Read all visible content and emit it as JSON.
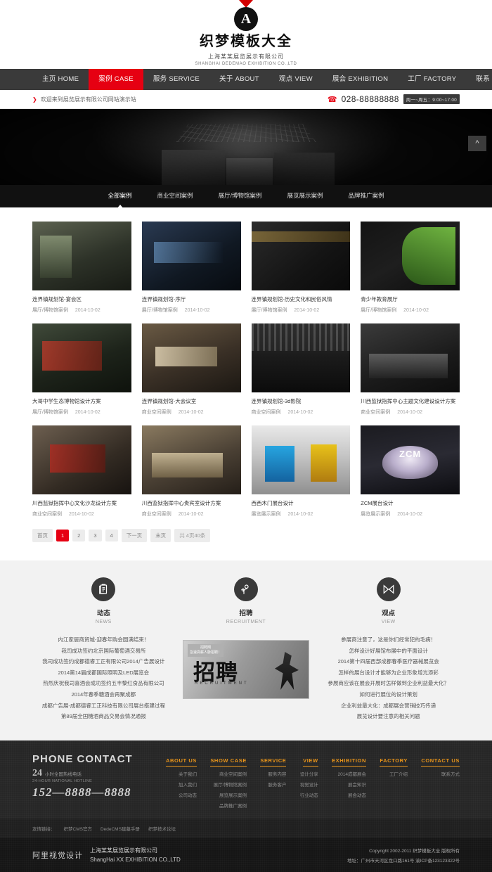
{
  "header": {
    "logo_letter": "A",
    "logo_title": "织梦模板大全",
    "company_cn": "上海某某展览展示有限公司",
    "company_en": "SHANGHAI DEDEMAO EXHIBITION CO.,LTD"
  },
  "nav": {
    "items": [
      {
        "label": "主页 HOME",
        "active": false
      },
      {
        "label": "案例 CASE",
        "active": true
      },
      {
        "label": "服务 SERVICE",
        "active": false
      },
      {
        "label": "关于 ABOUT",
        "active": false
      },
      {
        "label": "观点 VIEW",
        "active": false
      },
      {
        "label": "展会 EXHIBITION",
        "active": false
      },
      {
        "label": "工厂 FACTORY",
        "active": false
      },
      {
        "label": "联系 CONTACT",
        "active": false
      }
    ]
  },
  "welcome": {
    "text": "欢迎来到展览展示有限公司网站演示站",
    "arrow": "❯",
    "phone_icon": "phone-icon",
    "phone": "028-88888888",
    "hours_badge": "周一~周五：9:00~17:00"
  },
  "banner": {
    "backtop_icon": "chevron-up-icon"
  },
  "categories": [
    {
      "label": "全部案例",
      "active": true
    },
    {
      "label": "商业空间案例",
      "active": false
    },
    {
      "label": "展厅/博物馆案例",
      "active": false
    },
    {
      "label": "展览展示案例",
      "active": false
    },
    {
      "label": "品牌推广案例",
      "active": false
    }
  ],
  "cases": [
    {
      "title": "连界镇规划馆-宴会区",
      "cat": "展厅/博物馆案例",
      "date": "2014-10-02",
      "scene": "sc1"
    },
    {
      "title": "连界镇规划馆-序厅",
      "cat": "展厅/博物馆案例",
      "date": "2014-10-02",
      "scene": "sc2"
    },
    {
      "title": "连界镇规划馆-历史文化和民俗风情",
      "cat": "展厅/博物馆案例",
      "date": "2014-10-02",
      "scene": "sc3"
    },
    {
      "title": "青少年教育展厅",
      "cat": "展厅/博物馆案例",
      "date": "2014-10-02",
      "scene": "sc5"
    },
    {
      "title": "大哥中学生态博物馆设计方案",
      "cat": "展厅/博物馆案例",
      "date": "2014-10-02",
      "scene": "sc6"
    },
    {
      "title": "连界镇规划馆-大会议室",
      "cat": "商业空间案例",
      "date": "2014-10-02",
      "scene": "sc7"
    },
    {
      "title": "连界镇规划馆-3d影院",
      "cat": "商业空间案例",
      "date": "2014-10-02",
      "scene": "sc8"
    },
    {
      "title": "川西监狱指挥中心主题文化建设设计方案",
      "cat": "商业空间案例",
      "date": "2014-10-02",
      "scene": "sc9"
    },
    {
      "title": "川西监狱指挥中心文化沙龙设计方案",
      "cat": "商业空间案例",
      "date": "2014-10-02",
      "scene": "sc10"
    },
    {
      "title": "川西监狱指挥中心贵宾室设计方案",
      "cat": "商业空间案例",
      "date": "2014-10-02",
      "scene": "sc11"
    },
    {
      "title": "西西木门展台设计",
      "cat": "展览展示案例",
      "date": "2014-10-02",
      "scene": "sc12"
    },
    {
      "title": "ZCM展台设计",
      "cat": "展览展示案例",
      "date": "2014-10-02",
      "scene": "sc13",
      "overlay_text": "ZCM"
    }
  ],
  "pager": {
    "first": "首页",
    "pages": [
      "1",
      "2",
      "3",
      "4"
    ],
    "current": "1",
    "next": "下一页",
    "last": "末页",
    "info": "共 4页40条"
  },
  "info_section": {
    "columns": [
      {
        "icon": "clipboard-icon",
        "cn": "动态",
        "en": "NEWS"
      },
      {
        "icon": "recruit-person-icon",
        "cn": "招聘",
        "en": "RECRUITMENT"
      },
      {
        "icon": "bowtie-icon",
        "cn": "观点",
        "en": "VIEW"
      }
    ],
    "news": [
      "内江家居商贸城-迎春年购会圆满结束！",
      "我司成功签约北京国际葡萄酒交易所",
      "我司成功签约成都德睿工正有限公司2014广告展设计",
      "2014第14届成都国际照明及LED展览会",
      "热烈庆祝我司喜酒会成功签约五丰黎红食品有限公司",
      "2014年春季糖酒会再聚成都",
      "成都广告展-成都德睿工正科技有限公司展台搭建过程",
      "第89届全国糖酒商品交易会情况通报"
    ],
    "recruit": {
      "badge": "招聘网\n急速高薪人脉招聘！",
      "big": "招聘",
      "sub": "RECRUITMENT"
    },
    "views": [
      "参展商注意了，这是你们经常犯的毛病！",
      "怎样设计好展馆布展中的平面设计",
      "2014第十四届西部成都春季医疗器械展览会",
      "怎样的展台设计才能够为企业形象增光添彩",
      "参展商应该在展会开展时怎样做到企业利益最大化？",
      "如何进行展位的设计策划",
      "企业利益最大化：成都展会营销技巧传递",
      "展览设计要注意的相关问题"
    ]
  },
  "footer": {
    "contact": {
      "title": "PHONE CONTACT",
      "num24": "24",
      "cn": "小时全国热线电话",
      "en": "24-HOUR NATIONAL HOTLINE",
      "phone": "152—8888—8888"
    },
    "columns": [
      {
        "head": "ABOUT US",
        "links": [
          "关于我们",
          "加入我们",
          "公司动态"
        ]
      },
      {
        "head": "SHOW CASE",
        "links": [
          "商业空间案例",
          "展厅/博物馆案例",
          "展览展示案例",
          "品牌推广案例"
        ]
      },
      {
        "head": "SERVICE",
        "links": [
          "服务内容",
          "服务客户"
        ]
      },
      {
        "head": "VIEW",
        "links": [
          "设计分享",
          "视觉设计",
          "行业动态"
        ]
      },
      {
        "head": "EXHIBITION",
        "links": [
          "2014成都展会",
          "展会知识",
          "展会动态"
        ]
      },
      {
        "head": "FACTORY",
        "links": [
          "工厂介绍"
        ]
      },
      {
        "head": "CONTACT US",
        "links": [
          "联系方式"
        ]
      }
    ]
  },
  "friend_links": {
    "label": "友情链接：",
    "items": [
      "织梦CMS官方",
      "DedeCMS建墓手册",
      "织梦技术论坛"
    ]
  },
  "copyright": {
    "brand": "阿里视觉设计",
    "company_cn": "上海某某展览展示有限公司",
    "company_en": "ShangHai XX EXHIBITION CO.,LTD",
    "line1": "Copyright 2002-2011 织梦模板大全 版权所有",
    "line2": "地址：广州市天河区龙口路161号 渝ICP备123123322号"
  },
  "colors": {
    "accent_red": "#e60012",
    "nav_dark": "#3a3a3a",
    "footer_orange": "#e8941a"
  }
}
